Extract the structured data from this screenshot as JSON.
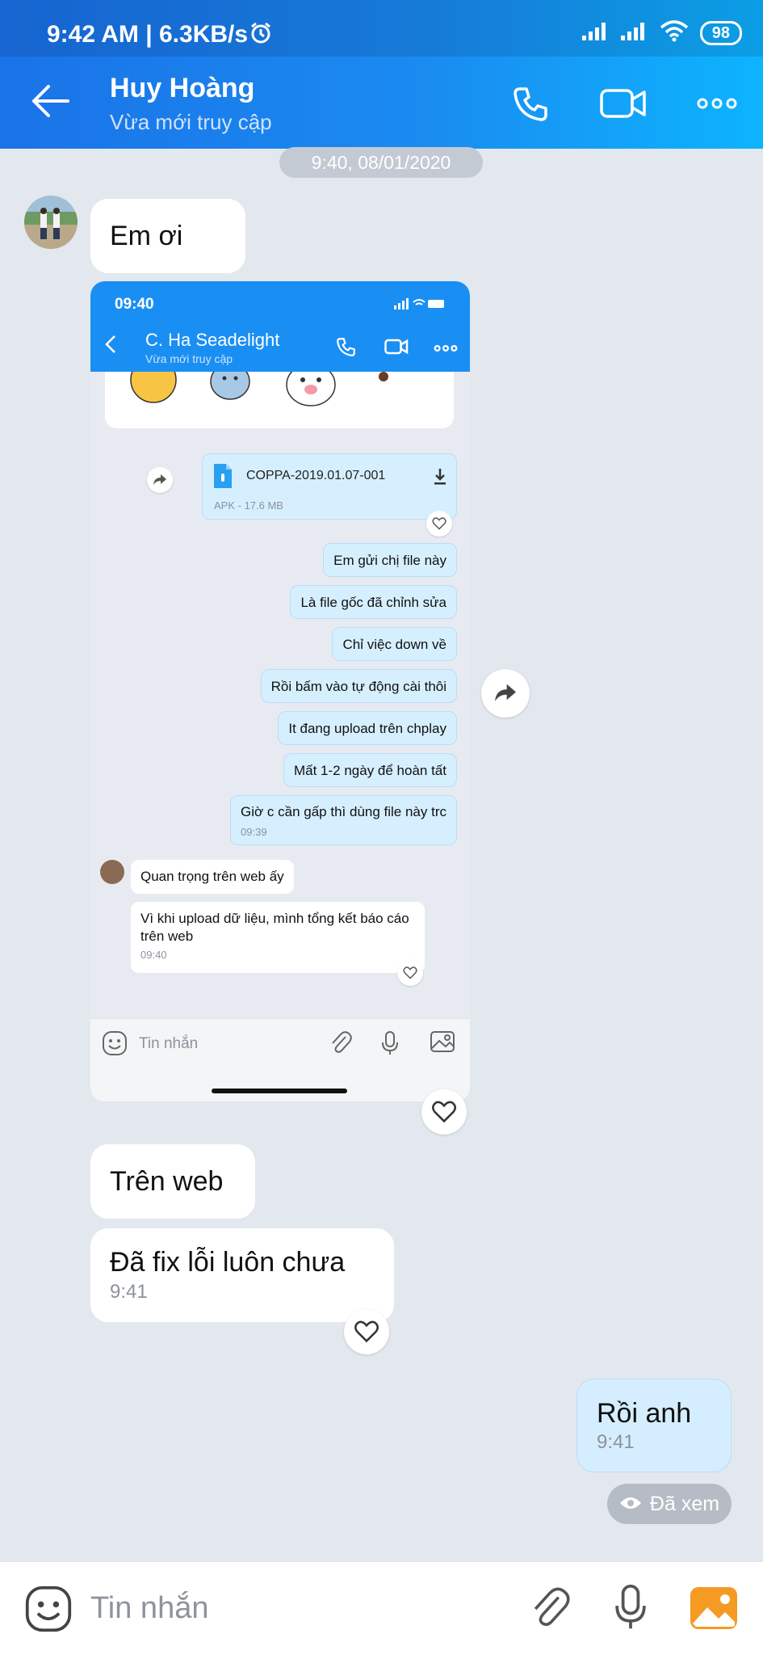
{
  "status_bar": {
    "time": "9:42 AM | 6.3KB/s",
    "battery": "98"
  },
  "header": {
    "contact_name": "Huy Hoàng",
    "contact_status": "Vừa mới truy cập"
  },
  "chat": {
    "date_divider": "9:40, 08/01/2020",
    "messages": {
      "m1": {
        "text": "Em ơi"
      },
      "m2": {
        "text": "Trên web"
      },
      "m3": {
        "text": "Đã fix lỗi luôn chưa",
        "time": "9:41"
      },
      "m4": {
        "text": "Rồi anh",
        "time": "9:41"
      }
    },
    "seen_label": "Đã xem"
  },
  "shared_screenshot": {
    "time": "09:40",
    "contact_name": "C. Ha Seadelight",
    "contact_status": "Vừa mới truy cập",
    "file": {
      "name": "COPPA-2019.01.07-001",
      "meta": "APK - 17.6 MB"
    },
    "outgoing": [
      "Em gửi chị file này",
      "Là file gốc đã chỉnh sửa",
      "Chỉ việc down về",
      "Rồi bấm vào tự động cài thôi",
      "It đang upload trên chplay",
      "Mất 1-2 ngày để hoàn tất",
      "Giờ c cần gấp thì dùng file này trc"
    ],
    "outgoing_time": "09:39",
    "incoming": {
      "m1": "Quan trọng trên web ấy",
      "m2": "Vì khi upload dữ liệu, mình tổng kết báo cáo trên web",
      "m2_time": "09:40"
    },
    "input_placeholder": "Tin nhắn"
  },
  "composer": {
    "placeholder": "Tin nhắn"
  }
}
